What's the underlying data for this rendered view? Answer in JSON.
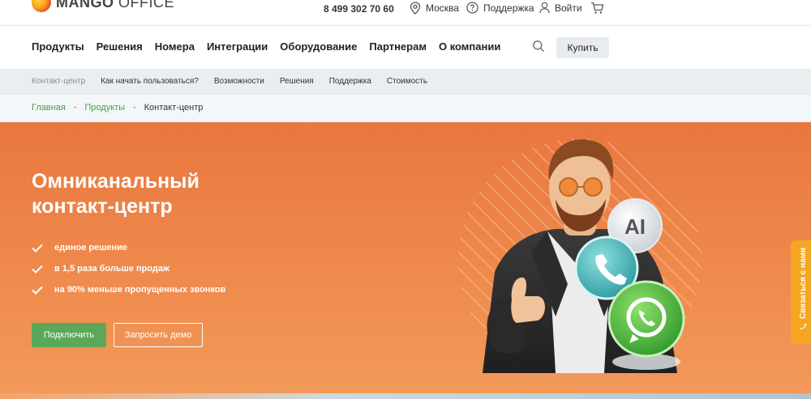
{
  "brand": {
    "name_bold": "MANGO",
    "name_light": "OFFICE"
  },
  "topbar": {
    "phone": "8 499 302 70 60",
    "city": "Москва",
    "support": "Поддержка",
    "login": "Войти"
  },
  "nav": {
    "items": [
      "Продукты",
      "Решения",
      "Номера",
      "Интеграции",
      "Оборудование",
      "Партнерам",
      "О компании"
    ],
    "buy_label": "Купить"
  },
  "subnav": {
    "items": [
      "Контакт-центр",
      "Как начать пользоваться?",
      "Возможности",
      "Решения",
      "Поддержка",
      "Стоимость"
    ]
  },
  "breadcrumb": {
    "items": [
      "Главная",
      "Продукты"
    ],
    "current": "Контакт-центр"
  },
  "hero": {
    "title_line1": "Омниканальный",
    "title_line2": "контакт-центр",
    "benefits": [
      "единое решение",
      "в 1,5 раза больше продаж",
      "на 90% меньше пропущенных звонков"
    ],
    "connect_label": "Подключить",
    "demo_label": "Запросить демо",
    "ai_badge": "AI"
  },
  "contact_tab": {
    "label": "Связаться с нами"
  },
  "colors": {
    "hero_orange": "#ec7e45",
    "brand_green": "#5ba85a",
    "link_green": "#43a047",
    "tab_orange": "#f5a623"
  }
}
